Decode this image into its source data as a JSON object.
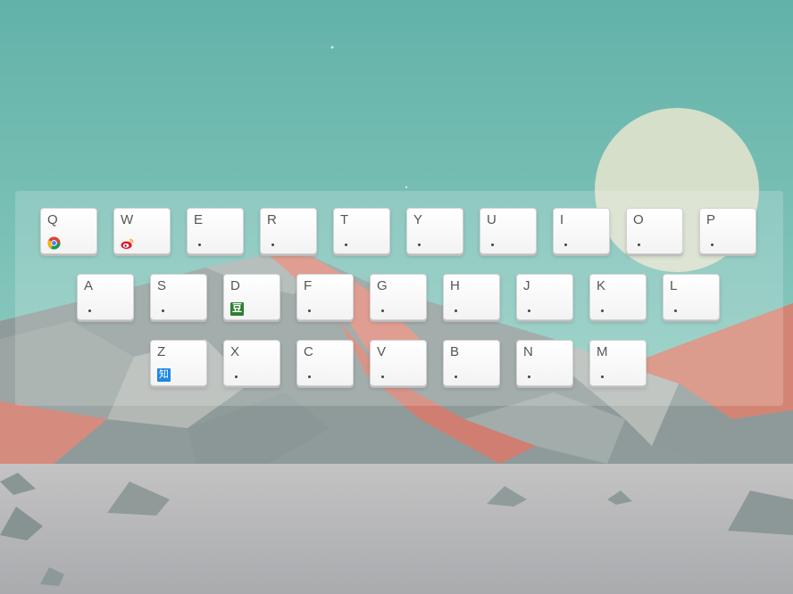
{
  "background": {
    "sky_top": "#66b6ad",
    "sky_bottom": "#9ad2c8",
    "sun": "#d9e1cc",
    "ground": "#b8b9bc",
    "mountain_red": "#de8a7a",
    "mountain_gray": "#9aa6a6"
  },
  "keyboard": {
    "rows": [
      {
        "keys": [
          {
            "letter": "Q",
            "icon": "chrome-icon"
          },
          {
            "letter": "W",
            "icon": "weibo-icon"
          },
          {
            "letter": "E",
            "icon": "dot-icon"
          },
          {
            "letter": "R",
            "icon": "dot-icon"
          },
          {
            "letter": "T",
            "icon": "dot-icon"
          },
          {
            "letter": "Y",
            "icon": "dot-icon"
          },
          {
            "letter": "U",
            "icon": "dot-icon"
          },
          {
            "letter": "I",
            "icon": "dot-icon"
          },
          {
            "letter": "O",
            "icon": "dot-icon"
          },
          {
            "letter": "P",
            "icon": "dot-icon"
          }
        ]
      },
      {
        "keys": [
          {
            "letter": "A",
            "icon": "dot-icon"
          },
          {
            "letter": "S",
            "icon": "dot-icon"
          },
          {
            "letter": "D",
            "icon": "douban-icon",
            "icon_text": "豆"
          },
          {
            "letter": "F",
            "icon": "dot-icon"
          },
          {
            "letter": "G",
            "icon": "dot-icon"
          },
          {
            "letter": "H",
            "icon": "dot-icon"
          },
          {
            "letter": "J",
            "icon": "dot-icon"
          },
          {
            "letter": "K",
            "icon": "dot-icon"
          },
          {
            "letter": "L",
            "icon": "dot-icon"
          }
        ]
      },
      {
        "keys": [
          {
            "letter": "Z",
            "icon": "zhihu-icon",
            "icon_text": "知"
          },
          {
            "letter": "X",
            "icon": "dot-icon"
          },
          {
            "letter": "C",
            "icon": "dot-icon"
          },
          {
            "letter": "V",
            "icon": "dot-icon"
          },
          {
            "letter": "B",
            "icon": "dot-icon"
          },
          {
            "letter": "N",
            "icon": "dot-icon"
          },
          {
            "letter": "M",
            "icon": "dot-icon"
          }
        ]
      }
    ]
  }
}
